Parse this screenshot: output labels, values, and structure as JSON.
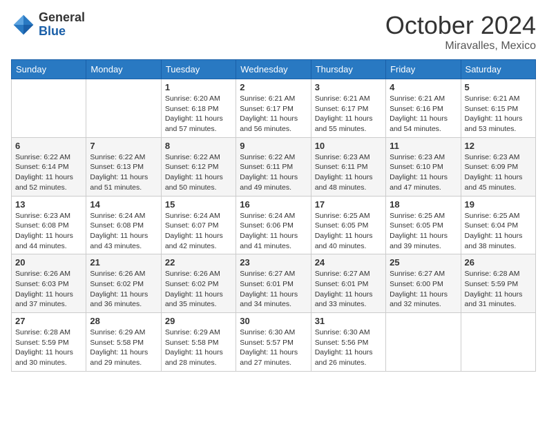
{
  "header": {
    "logo_general": "General",
    "logo_blue": "Blue",
    "month_title": "October 2024",
    "location": "Miravalles, Mexico"
  },
  "weekdays": [
    "Sunday",
    "Monday",
    "Tuesday",
    "Wednesday",
    "Thursday",
    "Friday",
    "Saturday"
  ],
  "weeks": [
    [
      {
        "day": "",
        "sunrise": "",
        "sunset": "",
        "daylight": ""
      },
      {
        "day": "",
        "sunrise": "",
        "sunset": "",
        "daylight": ""
      },
      {
        "day": "1",
        "sunrise": "Sunrise: 6:20 AM",
        "sunset": "Sunset: 6:18 PM",
        "daylight": "Daylight: 11 hours and 57 minutes."
      },
      {
        "day": "2",
        "sunrise": "Sunrise: 6:21 AM",
        "sunset": "Sunset: 6:17 PM",
        "daylight": "Daylight: 11 hours and 56 minutes."
      },
      {
        "day": "3",
        "sunrise": "Sunrise: 6:21 AM",
        "sunset": "Sunset: 6:17 PM",
        "daylight": "Daylight: 11 hours and 55 minutes."
      },
      {
        "day": "4",
        "sunrise": "Sunrise: 6:21 AM",
        "sunset": "Sunset: 6:16 PM",
        "daylight": "Daylight: 11 hours and 54 minutes."
      },
      {
        "day": "5",
        "sunrise": "Sunrise: 6:21 AM",
        "sunset": "Sunset: 6:15 PM",
        "daylight": "Daylight: 11 hours and 53 minutes."
      }
    ],
    [
      {
        "day": "6",
        "sunrise": "Sunrise: 6:22 AM",
        "sunset": "Sunset: 6:14 PM",
        "daylight": "Daylight: 11 hours and 52 minutes."
      },
      {
        "day": "7",
        "sunrise": "Sunrise: 6:22 AM",
        "sunset": "Sunset: 6:13 PM",
        "daylight": "Daylight: 11 hours and 51 minutes."
      },
      {
        "day": "8",
        "sunrise": "Sunrise: 6:22 AM",
        "sunset": "Sunset: 6:12 PM",
        "daylight": "Daylight: 11 hours and 50 minutes."
      },
      {
        "day": "9",
        "sunrise": "Sunrise: 6:22 AM",
        "sunset": "Sunset: 6:11 PM",
        "daylight": "Daylight: 11 hours and 49 minutes."
      },
      {
        "day": "10",
        "sunrise": "Sunrise: 6:23 AM",
        "sunset": "Sunset: 6:11 PM",
        "daylight": "Daylight: 11 hours and 48 minutes."
      },
      {
        "day": "11",
        "sunrise": "Sunrise: 6:23 AM",
        "sunset": "Sunset: 6:10 PM",
        "daylight": "Daylight: 11 hours and 47 minutes."
      },
      {
        "day": "12",
        "sunrise": "Sunrise: 6:23 AM",
        "sunset": "Sunset: 6:09 PM",
        "daylight": "Daylight: 11 hours and 45 minutes."
      }
    ],
    [
      {
        "day": "13",
        "sunrise": "Sunrise: 6:23 AM",
        "sunset": "Sunset: 6:08 PM",
        "daylight": "Daylight: 11 hours and 44 minutes."
      },
      {
        "day": "14",
        "sunrise": "Sunrise: 6:24 AM",
        "sunset": "Sunset: 6:08 PM",
        "daylight": "Daylight: 11 hours and 43 minutes."
      },
      {
        "day": "15",
        "sunrise": "Sunrise: 6:24 AM",
        "sunset": "Sunset: 6:07 PM",
        "daylight": "Daylight: 11 hours and 42 minutes."
      },
      {
        "day": "16",
        "sunrise": "Sunrise: 6:24 AM",
        "sunset": "Sunset: 6:06 PM",
        "daylight": "Daylight: 11 hours and 41 minutes."
      },
      {
        "day": "17",
        "sunrise": "Sunrise: 6:25 AM",
        "sunset": "Sunset: 6:05 PM",
        "daylight": "Daylight: 11 hours and 40 minutes."
      },
      {
        "day": "18",
        "sunrise": "Sunrise: 6:25 AM",
        "sunset": "Sunset: 6:05 PM",
        "daylight": "Daylight: 11 hours and 39 minutes."
      },
      {
        "day": "19",
        "sunrise": "Sunrise: 6:25 AM",
        "sunset": "Sunset: 6:04 PM",
        "daylight": "Daylight: 11 hours and 38 minutes."
      }
    ],
    [
      {
        "day": "20",
        "sunrise": "Sunrise: 6:26 AM",
        "sunset": "Sunset: 6:03 PM",
        "daylight": "Daylight: 11 hours and 37 minutes."
      },
      {
        "day": "21",
        "sunrise": "Sunrise: 6:26 AM",
        "sunset": "Sunset: 6:02 PM",
        "daylight": "Daylight: 11 hours and 36 minutes."
      },
      {
        "day": "22",
        "sunrise": "Sunrise: 6:26 AM",
        "sunset": "Sunset: 6:02 PM",
        "daylight": "Daylight: 11 hours and 35 minutes."
      },
      {
        "day": "23",
        "sunrise": "Sunrise: 6:27 AM",
        "sunset": "Sunset: 6:01 PM",
        "daylight": "Daylight: 11 hours and 34 minutes."
      },
      {
        "day": "24",
        "sunrise": "Sunrise: 6:27 AM",
        "sunset": "Sunset: 6:01 PM",
        "daylight": "Daylight: 11 hours and 33 minutes."
      },
      {
        "day": "25",
        "sunrise": "Sunrise: 6:27 AM",
        "sunset": "Sunset: 6:00 PM",
        "daylight": "Daylight: 11 hours and 32 minutes."
      },
      {
        "day": "26",
        "sunrise": "Sunrise: 6:28 AM",
        "sunset": "Sunset: 5:59 PM",
        "daylight": "Daylight: 11 hours and 31 minutes."
      }
    ],
    [
      {
        "day": "27",
        "sunrise": "Sunrise: 6:28 AM",
        "sunset": "Sunset: 5:59 PM",
        "daylight": "Daylight: 11 hours and 30 minutes."
      },
      {
        "day": "28",
        "sunrise": "Sunrise: 6:29 AM",
        "sunset": "Sunset: 5:58 PM",
        "daylight": "Daylight: 11 hours and 29 minutes."
      },
      {
        "day": "29",
        "sunrise": "Sunrise: 6:29 AM",
        "sunset": "Sunset: 5:58 PM",
        "daylight": "Daylight: 11 hours and 28 minutes."
      },
      {
        "day": "30",
        "sunrise": "Sunrise: 6:30 AM",
        "sunset": "Sunset: 5:57 PM",
        "daylight": "Daylight: 11 hours and 27 minutes."
      },
      {
        "day": "31",
        "sunrise": "Sunrise: 6:30 AM",
        "sunset": "Sunset: 5:56 PM",
        "daylight": "Daylight: 11 hours and 26 minutes."
      },
      {
        "day": "",
        "sunrise": "",
        "sunset": "",
        "daylight": ""
      },
      {
        "day": "",
        "sunrise": "",
        "sunset": "",
        "daylight": ""
      }
    ]
  ]
}
